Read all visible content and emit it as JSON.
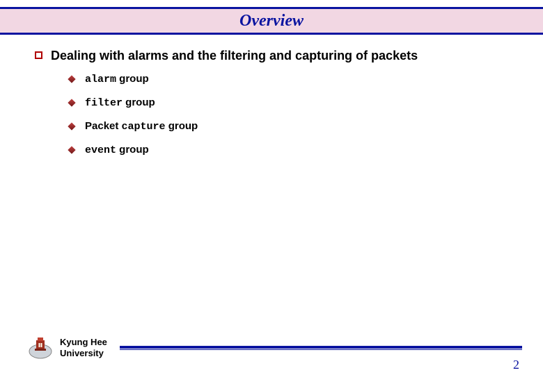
{
  "title": "Overview",
  "main_bullet": "Dealing with alarms and the filtering and capturing of packets",
  "sub": {
    "b0": {
      "mono": "alarm",
      "rest": " group"
    },
    "b1": {
      "mono": "filter",
      "rest": " group"
    },
    "b2": {
      "pre": "Packet ",
      "mono": "capture",
      "rest": " group"
    },
    "b3": {
      "mono": "event",
      "rest": " group"
    }
  },
  "footer": {
    "uni_line1": "Kyung Hee",
    "uni_line2": "University",
    "page": "2"
  }
}
